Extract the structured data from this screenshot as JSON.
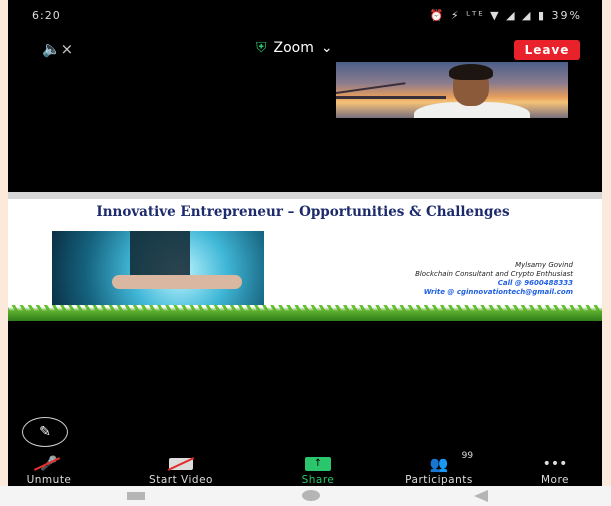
{
  "status": {
    "time": "6:20",
    "icons": "⏰ ⚡ ᴸᵀᴱ ▼ ◢ ◢ ▮",
    "battery": "39%"
  },
  "header": {
    "speaker_icon": "🔈×",
    "title": "Zoom",
    "shield_icon": "shield-icon",
    "leave_label": "Leave",
    "colors": {
      "leave": "#e8212a",
      "secure": "#2bc66b"
    }
  },
  "slide": {
    "title": "Innovative Entrepreneur – Opportunities & Challenges",
    "presenter_name": "Mylsamy Govind",
    "presenter_role": "Blockchain Consultant and Crypto Enthusiast",
    "call": "Call @ 9600488333",
    "write": "Write @ cginnovationtech@gmail.com"
  },
  "toolbar": {
    "unmute": "Unmute",
    "start_video": "Start Video",
    "share": "Share",
    "participants": "Participants",
    "participants_count": "99",
    "more": "More"
  }
}
